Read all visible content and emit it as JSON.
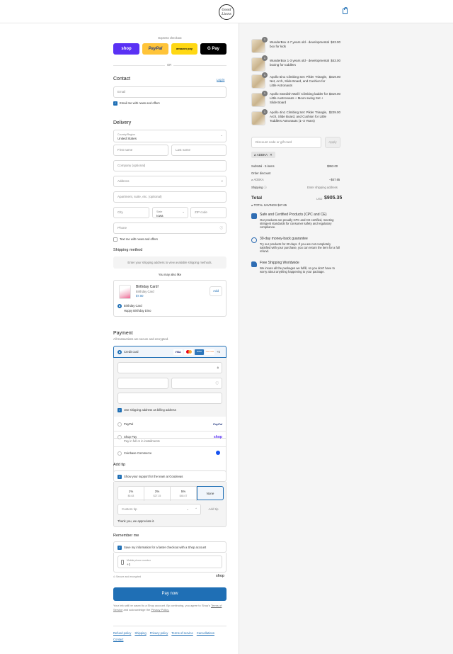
{
  "header": {
    "logo_text": "Good Lions",
    "cart_icon": "shopping-bag-icon"
  },
  "express": {
    "label": "Express checkout",
    "buttons": [
      {
        "label": "shop",
        "color": "#5a31f4"
      },
      {
        "label": "PayPal",
        "color": "#ffc439"
      },
      {
        "label": "amazon pay",
        "color": "#ffd814"
      },
      {
        "label": "G Pay",
        "color": "#000000"
      }
    ],
    "or": "OR"
  },
  "contact": {
    "title": "Contact",
    "login": "Log in",
    "email_placeholder": "Email",
    "news_label": "Email me with news and offers"
  },
  "delivery": {
    "title": "Delivery",
    "country_label": "Country/Region",
    "country_value": "United States",
    "first_name": "First name",
    "last_name": "Last name",
    "company": "Company (optional)",
    "address": "Address",
    "apartment": "Apartment, suite, etc. (optional)",
    "city": "City",
    "state_label": "State",
    "state_value": "Iowa",
    "zip": "ZIP code",
    "phone": "Phone",
    "text_me": "Text me with news and offers"
  },
  "shipping": {
    "title": "Shipping method",
    "notice": "Enter your shipping address to view available shipping methods."
  },
  "upsell": {
    "title": "You may also like",
    "product_name": "Birthday Card!",
    "product_sub": "Birthday Card",
    "price": "$7.00",
    "add_label": "Add",
    "option_line1": "Birthday Card",
    "option_line2": "Happy Birthday Dino"
  },
  "payment": {
    "title": "Payment",
    "subtitle": "All transactions are secure and encrypted.",
    "credit_card": "Credit card",
    "card_logos": [
      "VISA",
      "MC",
      "AMEX",
      "DISCOVER",
      "+5"
    ],
    "billing_same": "Use shipping address as billing address",
    "paypal": "PayPal",
    "paypal_logo": "PayPal",
    "shop_pay": "Shop Pay",
    "shop_pay_sub": "Pay in full or in installments",
    "shop_pay_logo": "shop",
    "coinbase": "Coinbase Commerce"
  },
  "tip": {
    "title": "Add tip",
    "support_label": "Show your support for the team at Goodevas",
    "options": [
      {
        "pct": "1%",
        "amount": "$5.63"
      },
      {
        "pct": "3%",
        "amount": "$27.15"
      },
      {
        "pct": "5%",
        "amount": "$45.07"
      },
      {
        "pct": "None",
        "amount": ""
      }
    ],
    "custom_placeholder": "Custom tip",
    "add_tip": "Add tip",
    "thanks": "Thank you, we appreciate it."
  },
  "remember": {
    "title": "Remember me",
    "save_label": "Save my information for a faster checkout with a Shop account",
    "phone_label": "Mobile phone number",
    "phone_value": "+1",
    "secure": "Secure and encrypted",
    "shop_logo": "shop"
  },
  "pay_now": "Pay now",
  "legal": {
    "text": "Your info will be saved to a Shop account. By continuing, you agree to Shop's",
    "terms": "Terms of Service",
    "and": "and acknowledge the",
    "privacy": "Privacy Policy."
  },
  "footer_links": [
    "Refund policy",
    "Shipping",
    "Privacy policy",
    "Terms of service",
    "Cancellations",
    "Contact"
  ],
  "order": {
    "items": [
      {
        "qty": "1",
        "title": "WunderBox 4-7 years old - developmental box for kids",
        "price": "$43.00"
      },
      {
        "qty": "1",
        "title": "WunderBox 1-3 years old - developmental boxing for toddlers",
        "price": "$43.00"
      },
      {
        "qty": "1",
        "title": "Apollo 5in1 Climbing Set: Pikler Triangle, Net, Arch, Slide Board, and Cushion for Little Astronauts",
        "price": "$319.00"
      },
      {
        "qty": "1",
        "title": "Apollo Swedish Wall / Climbing ladder for Little Austronauts + Moon swing Set + Slide Board",
        "price": "$319.00"
      },
      {
        "qty": "1",
        "title": "Apollo 4in1 Climbing Set: Pikler Triangle, Arch, Slide Board, and Cushion for Little Toddlers Astronauts (1–3 Years)",
        "price": "$229.00"
      }
    ],
    "discount_placeholder": "Discount code or gift card",
    "apply": "Apply",
    "applied_code": "ADBKA",
    "subtotal_label": "Subtotal · 5 items",
    "subtotal_value": "$953.00",
    "order_discount": "Order discount",
    "discount_code": "ADBKA",
    "discount_value": "−$47.65",
    "shipping_label": "Shipping",
    "shipping_value": "Enter shipping address",
    "total_label": "Total",
    "currency": "USD",
    "total_value": "$905.35",
    "savings_label": "TOTAL SAVINGS",
    "savings_value": "$47.65"
  },
  "badges": [
    {
      "title": "Safe and Certified Products (CPC and CE)",
      "text": "Our products are proudly CPC and CE certified, meeting stringent standards for consumer safety and regulatory compliance."
    },
    {
      "title": "30-day money-back guarantee",
      "text": "Try our products for 30 days. If you are not completely satisfied with your purchase, you can return the item for a full refund."
    },
    {
      "title": "Free Shipping Worldwide",
      "text": "We insure all the packages we fulfill, so you don't have to worry about anything happening to your package."
    }
  ]
}
